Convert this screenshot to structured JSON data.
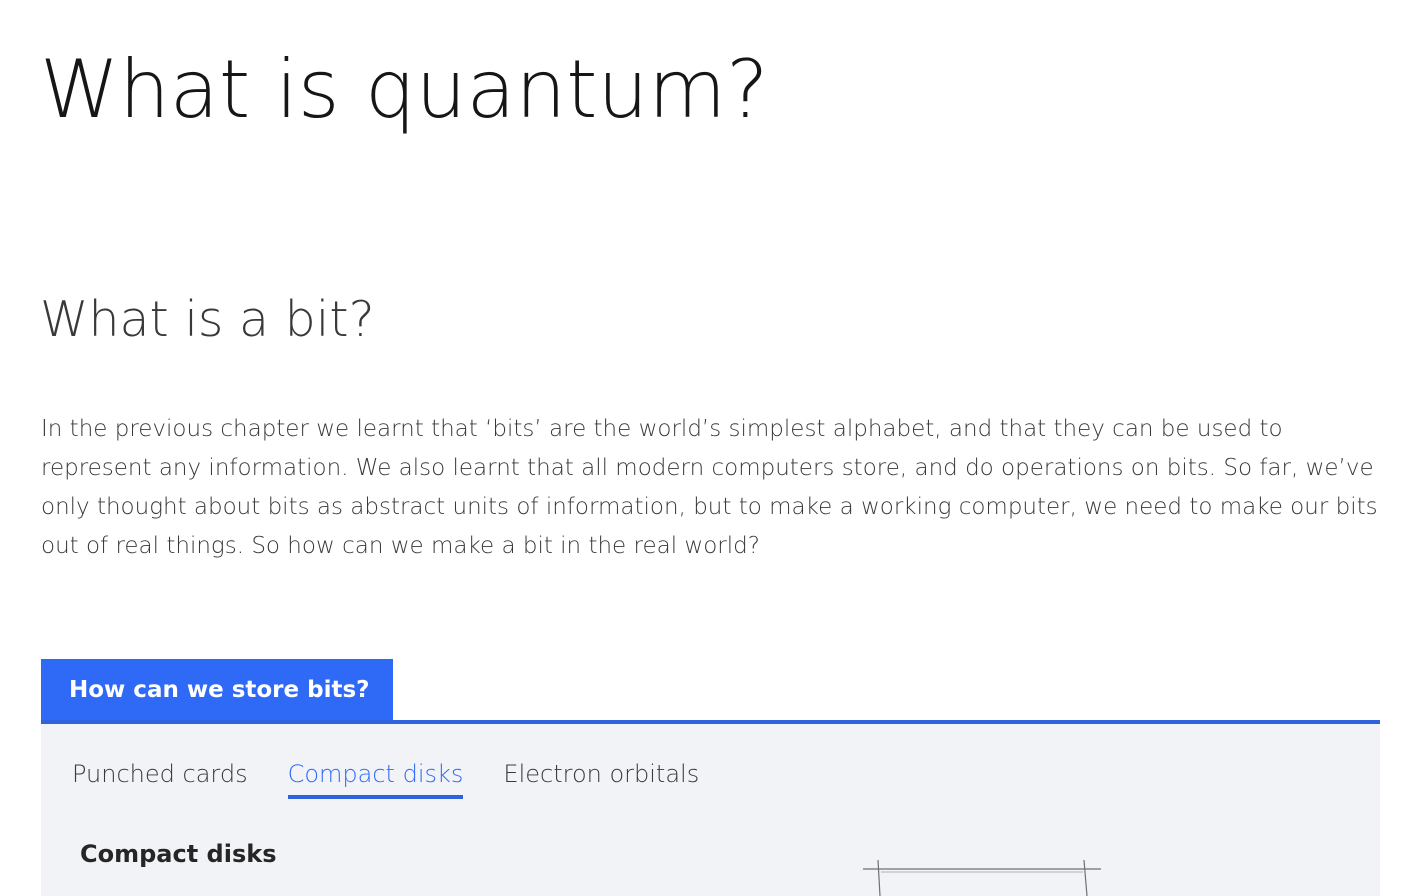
{
  "page": {
    "title": "What is quantum?",
    "subtitle": "What is a bit?",
    "intro": "In the previous chapter we learnt that ‘bits’ are the world’s simplest alphabet, and that they can be used to represent any information. We also learnt that all modern computers store, and do operations on bits. So far, we’ve only thought about bits as abstract units of information, but to make a working computer, we need to make our bits out of real things. So how can we make a bit in the real world?"
  },
  "widget": {
    "header_label": "How can we store bits?",
    "tabs": [
      {
        "label": "Punched cards",
        "active": false
      },
      {
        "label": "Compact disks",
        "active": true
      },
      {
        "label": "Electron orbitals",
        "active": false
      }
    ],
    "section_heading": "Compact disks"
  },
  "colors": {
    "accent": "#2f6af6",
    "panel_background": "#f2f3f7"
  }
}
